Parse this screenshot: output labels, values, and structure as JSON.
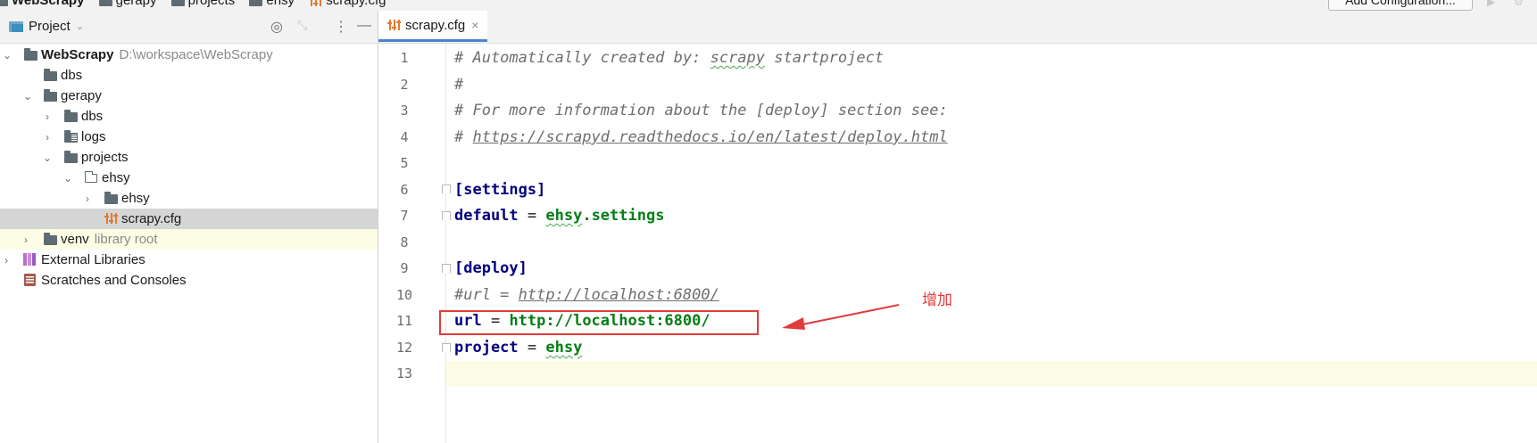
{
  "navbar": {
    "crumbs": [
      "WebScrapy",
      "gerapy",
      "projects",
      "ehsy",
      "scrapy.cfg"
    ],
    "run_config_label": "Add Configuration..."
  },
  "project_panel": {
    "title": "Project",
    "tree": [
      {
        "label": "WebScrapy",
        "hint": "D:\\workspace\\WebScrapy",
        "depth": 0,
        "expanded": true,
        "icon": "folder-icon",
        "bold": true
      },
      {
        "label": "dbs",
        "depth": 1,
        "icon": "folder-icon"
      },
      {
        "label": "gerapy",
        "depth": 1,
        "expanded": true,
        "icon": "folder-icon"
      },
      {
        "label": "dbs",
        "depth": 2,
        "collapsed": true,
        "icon": "folder-icon"
      },
      {
        "label": "logs",
        "depth": 2,
        "collapsed": true,
        "icon": "logs-folder-icon"
      },
      {
        "label": "projects",
        "depth": 2,
        "expanded": true,
        "icon": "folder-icon"
      },
      {
        "label": "ehsy",
        "depth": 3,
        "expanded": true,
        "icon": "package-folder-icon"
      },
      {
        "label": "ehsy",
        "depth": 4,
        "collapsed": true,
        "icon": "folder-icon"
      },
      {
        "label": "scrapy.cfg",
        "depth": 5,
        "icon": "config-file-icon",
        "selected": true
      },
      {
        "label": "venv",
        "hint": "library root",
        "depth": 1,
        "collapsed": true,
        "icon": "folder-icon"
      },
      {
        "label": "External Libraries",
        "depth": 0,
        "collapsed": true,
        "icon": "external-libraries-icon"
      },
      {
        "label": "Scratches and Consoles",
        "depth": 0,
        "icon": "scratches-icon"
      }
    ]
  },
  "editor": {
    "tab_label": "scrapy.cfg",
    "lines": [
      {
        "n": "1",
        "text": "# Automatically created by: scrapy startproject"
      },
      {
        "n": "2",
        "text": "#"
      },
      {
        "n": "3",
        "text": "# For more information about the [deploy] section see:"
      },
      {
        "n": "4",
        "text": "# https://scrapyd.readthedocs.io/en/latest/deploy.html"
      },
      {
        "n": "5",
        "text": ""
      },
      {
        "n": "6",
        "text": "[settings]"
      },
      {
        "n": "7",
        "text": "default = ehsy.settings"
      },
      {
        "n": "8",
        "text": ""
      },
      {
        "n": "9",
        "text": "[deploy]"
      },
      {
        "n": "10",
        "text": "#url = http://localhost:6800/"
      },
      {
        "n": "11",
        "text": "url = http://localhost:6800/"
      },
      {
        "n": "12",
        "text": "project = ehsy"
      },
      {
        "n": "13",
        "text": ""
      }
    ]
  },
  "annotation": {
    "label": "增加",
    "color": "#e23b3b"
  }
}
